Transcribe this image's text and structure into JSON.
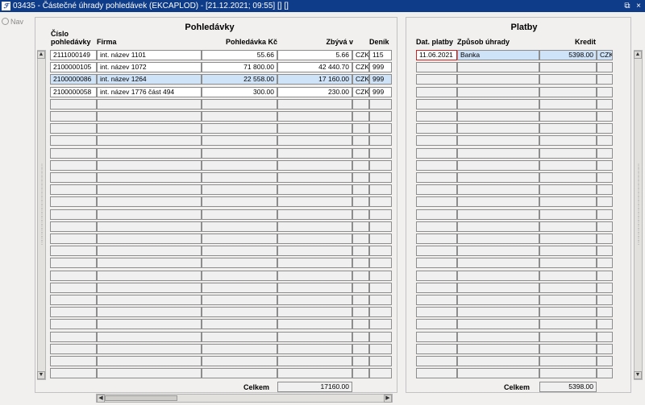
{
  "window": {
    "title": "03435 - Částečné úhrady pohledávek (EKCAPLOD) - [21.12.2021; 09:55] [] []",
    "app_icon": "app-icon",
    "restore_icon": "⧉",
    "close_icon": "×"
  },
  "nav": {
    "label": "Nav"
  },
  "left": {
    "title": "Pohledávky",
    "headers": {
      "cislo_line1": "Číslo",
      "cislo_line2": "pohledávky",
      "firma": "Firma",
      "pohledavka": "Pohledávka Kč",
      "zbyva": "Zbývá v",
      "denik": "Deník"
    },
    "rows": [
      {
        "cislo": "2111000149",
        "firma": "int. název 1101",
        "pohledavka": "55.66",
        "zbyva": "5.66",
        "mena": "CZK",
        "denik": "115"
      },
      {
        "cislo": "2100000105",
        "firma": "int. název 1072",
        "pohledavka": "71 800.00",
        "zbyva": "42 440.70",
        "mena": "CZK",
        "denik": "999"
      },
      {
        "cislo": "2100000086",
        "firma": "int. název 1264",
        "pohledavka": "22 558.00",
        "zbyva": "17 160.00",
        "mena": "CZK",
        "denik": "999"
      },
      {
        "cislo": "2100000058",
        "firma": "int. název 1776 část 494",
        "pohledavka": "300.00",
        "zbyva": "230.00",
        "mena": "CZK",
        "denik": "999"
      }
    ],
    "selected_row": 2,
    "total_label": "Celkem",
    "total_value": "17160.00"
  },
  "right": {
    "title": "Platby",
    "headers": {
      "datum": "Dat. platby",
      "zpusob": "Způsob úhrady",
      "kredit": "Kredit"
    },
    "rows": [
      {
        "datum": "11.06.2021",
        "zpusob": "Banka",
        "kredit": "5398.00",
        "mena": "CZK"
      }
    ],
    "total_label": "Celkem",
    "total_value": "5398.00"
  },
  "scroll": {
    "up": "▲",
    "down": "▼",
    "left": "◀",
    "right": "▶"
  }
}
